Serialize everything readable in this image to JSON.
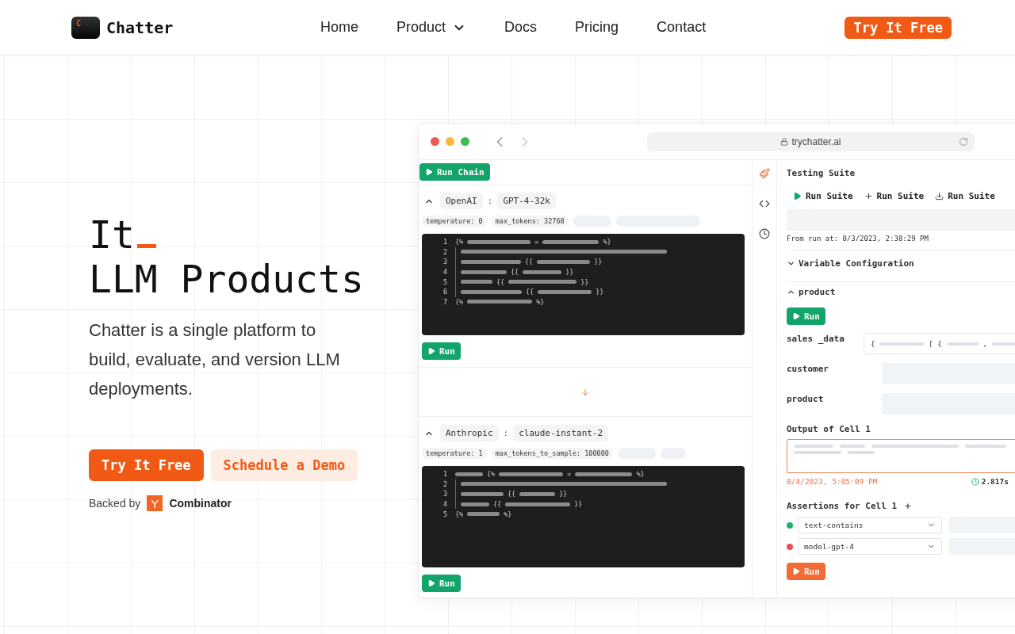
{
  "nav": {
    "brand": "Chatter",
    "logo_letter": "C",
    "links": [
      {
        "label": "Home",
        "dropdown": false
      },
      {
        "label": "Product",
        "dropdown": true
      },
      {
        "label": "Docs",
        "dropdown": false
      },
      {
        "label": "Pricing",
        "dropdown": false
      },
      {
        "label": "Contact",
        "dropdown": false
      }
    ],
    "cta": "Try It Free"
  },
  "hero": {
    "heading_lines": [
      "It",
      "LLM Products"
    ],
    "description": "Chatter is a single platform to build, evaluate, and version LLM deployments.",
    "buttons": [
      {
        "label": "Try It Free",
        "kind": "primary"
      },
      {
        "label": "Schedule a Demo",
        "kind": "secondary"
      }
    ],
    "backed_by": {
      "text": "Backed by",
      "badge": "Y",
      "name": "Combinator"
    }
  },
  "mockup": {
    "url": "trychatter.ai",
    "run_chain": "Run Chain",
    "models": [
      {
        "provider": "OpenAI",
        "separator": ":",
        "model": "GPT-4-32k",
        "expanded": true,
        "params": [
          "temperature: 0",
          "max_tokens: 32768"
        ],
        "run": "Run",
        "code": [
          {
            "number": "1",
            "indented": false,
            "tokens": [
              {
                "kind": "text",
                "text": "{%"
              },
              {
                "kind": "bar"
              },
              {
                "kind": "text",
                "text": "="
              },
              {
                "kind": "bar"
              },
              {
                "kind": "text",
                "text": "%}"
              }
            ]
          },
          {
            "number": "2",
            "indented": true,
            "tokens": [
              {
                "kind": "bar"
              }
            ]
          },
          {
            "number": "3",
            "indented": true,
            "tokens": [
              {
                "kind": "bar"
              },
              {
                "kind": "text",
                "text": "{{"
              },
              {
                "kind": "bar"
              },
              {
                "kind": "text",
                "text": "}}"
              }
            ]
          },
          {
            "number": "4",
            "indented": true,
            "tokens": [
              {
                "kind": "bar"
              },
              {
                "kind": "text",
                "text": "{{"
              },
              {
                "kind": "bar"
              },
              {
                "kind": "text",
                "text": "}}"
              }
            ]
          },
          {
            "number": "5",
            "indented": true,
            "tokens": [
              {
                "kind": "bar"
              },
              {
                "kind": "text",
                "text": "{{"
              },
              {
                "kind": "bar"
              },
              {
                "kind": "text",
                "text": "}}"
              }
            ]
          },
          {
            "number": "6",
            "indented": true,
            "tokens": [
              {
                "kind": "bar"
              },
              {
                "kind": "text",
                "text": "{{"
              },
              {
                "kind": "bar"
              },
              {
                "kind": "text",
                "text": "}}"
              }
            ]
          },
          {
            "number": "7",
            "indented": false,
            "tokens": [
              {
                "kind": "text",
                "text": "{%"
              },
              {
                "kind": "bar"
              },
              {
                "kind": "text",
                "text": "%}"
              }
            ]
          }
        ]
      },
      {
        "provider": "Anthropic",
        "separator": ":",
        "model": "claude-instant-2",
        "expanded": true,
        "params": [
          "temperature: 1",
          "max_tokens_to_sample: 100000"
        ],
        "run": "Run",
        "code": [
          {
            "number": "1",
            "indented": false,
            "tokens": [
              {
                "kind": "bar"
              },
              {
                "kind": "text",
                "text": "{%"
              },
              {
                "kind": "bar"
              },
              {
                "kind": "text",
                "text": "="
              },
              {
                "kind": "bar"
              },
              {
                "kind": "text",
                "text": "%}"
              }
            ]
          },
          {
            "number": "2",
            "indented": true,
            "tokens": [
              {
                "kind": "bar"
              }
            ]
          },
          {
            "number": "3",
            "indented": true,
            "tokens": [
              {
                "kind": "bar"
              },
              {
                "kind": "text",
                "text": "{{"
              },
              {
                "kind": "bar"
              },
              {
                "kind": "text",
                "text": "}}"
              }
            ]
          },
          {
            "number": "4",
            "indented": true,
            "tokens": [
              {
                "kind": "bar"
              },
              {
                "kind": "text",
                "text": "{{"
              },
              {
                "kind": "bar"
              },
              {
                "kind": "text",
                "text": "}}"
              }
            ]
          },
          {
            "number": "5",
            "indented": false,
            "tokens": [
              {
                "kind": "text",
                "text": "{%"
              },
              {
                "kind": "bar"
              },
              {
                "kind": "text",
                "text": "%}"
              }
            ]
          }
        ]
      }
    ],
    "rail": [
      {
        "kind": "brush",
        "selected": true
      },
      {
        "kind": "code",
        "selected": false
      },
      {
        "kind": "history",
        "selected": false
      }
    ],
    "suite": {
      "title": "Testing Suite",
      "actions": [
        {
          "kind": "play",
          "label": "Run Suite"
        },
        {
          "kind": "plus",
          "label": "Run Suite"
        },
        {
          "kind": "download",
          "label": "Run Suite"
        }
      ],
      "from_run": "From run at: 8/3/2023, 2:38:29 PM",
      "sections": [
        {
          "label": "Variable Configuration",
          "expanded": false
        },
        {
          "label": "product",
          "expanded": true
        }
      ],
      "run": "Run",
      "variables": [
        {
          "name": "sales _data",
          "filled": true,
          "value_tokens": [
            "{",
            "[ {",
            ","
          ]
        },
        {
          "name": "customer",
          "filled": false
        },
        {
          "name": "product",
          "filled": false
        }
      ],
      "output": {
        "title": "Output of Cell 1",
        "timestamp": "8/4/2023, 5:05:09 PM",
        "duration": "2.817s"
      },
      "assertions": {
        "title": "Assertions for Cell 1",
        "add": "+",
        "items": [
          {
            "label": "text-contains",
            "color": "#1fb26b"
          },
          {
            "label": "model-gpt-4",
            "color": "#ef4a5a"
          }
        ]
      },
      "final_run": "Run"
    }
  }
}
